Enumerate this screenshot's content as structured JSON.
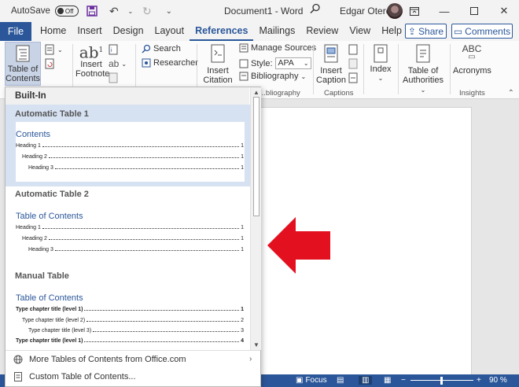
{
  "titlebar": {
    "autosave_label": "AutoSave",
    "autosave_state": "Off",
    "doc_title": "Document1 - Word",
    "user_name": "Edgar Otero"
  },
  "tabs": {
    "file": "File",
    "items": [
      "Home",
      "Insert",
      "Design",
      "Layout",
      "References",
      "Mailings",
      "Review",
      "View",
      "Help"
    ],
    "active": "References",
    "share": "Share",
    "comments": "Comments"
  },
  "ribbon": {
    "toc_line1": "Table of",
    "toc_line2": "Contents",
    "footnote_line1": "Insert",
    "footnote_line2": "Footnote",
    "search": "Search",
    "researcher": "Researcher",
    "citation_line1": "Insert",
    "citation_line2": "Citation",
    "manage_sources": "Manage Sources",
    "style_label": "Style:",
    "style_value": "APA",
    "bibliography": "Bibliography",
    "citations_group": "...bliography",
    "caption_line1": "Insert",
    "caption_line2": "Caption",
    "captions_group": "Captions",
    "index": "Index",
    "toa_line1": "Table of",
    "toa_line2": "Authorities",
    "acronyms_abc": "ABC",
    "acronyms": "Acronyms",
    "insights_group": "Insights"
  },
  "dropdown": {
    "header": "Built-In",
    "options": [
      {
        "title": "Automatic Table 1",
        "heading": "Contents",
        "rows": [
          {
            "text": "Heading 1",
            "page": "1"
          },
          {
            "text": "Heading 2",
            "page": "1"
          },
          {
            "text": "Heading 3",
            "page": "1"
          }
        ]
      },
      {
        "title": "Automatic Table 2",
        "heading": "Table of Contents",
        "rows": [
          {
            "text": "Heading 1",
            "page": "1"
          },
          {
            "text": "Heading 2",
            "page": "1"
          },
          {
            "text": "Heading 3",
            "page": "1"
          }
        ]
      },
      {
        "title": "Manual Table",
        "heading": "Table of Contents",
        "rows": [
          {
            "text": "Type chapter title (level 1)",
            "page": "1"
          },
          {
            "text": "Type chapter title (level 2)",
            "page": "2"
          },
          {
            "text": "Type chapter title (level 3)",
            "page": "3"
          },
          {
            "text": "Type chapter title (level 1)",
            "page": "4"
          }
        ]
      }
    ],
    "more_link": "More Tables of Contents from Office.com",
    "custom_link": "Custom Table of Contents..."
  },
  "statusbar": {
    "focus": "Focus",
    "zoom": "90 %"
  },
  "colors": {
    "accent": "#2b579a",
    "arrow": "#e3101f",
    "hover": "#d6e1f2"
  }
}
